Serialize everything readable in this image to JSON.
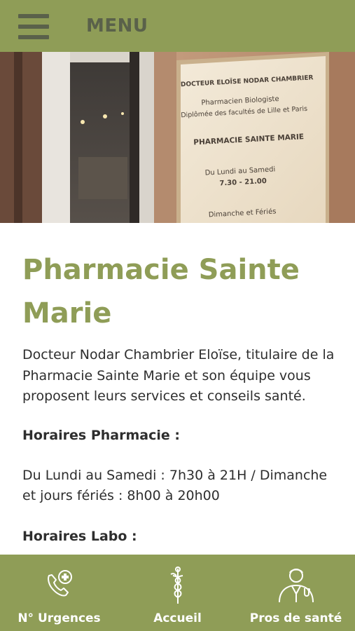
{
  "header": {
    "menu_icon": "hamburger-menu-icon",
    "menu_label": "MENU"
  },
  "hero": {
    "sign_lines": [
      "DOCTEUR ELOÏSE NODAR CHAMBRIER",
      "Pharmacien Biologiste",
      "Diplômée des facultés de Lille et Paris",
      "PHARMACIE SAINTE MARIE",
      "Du Lundi au Samedi",
      "7.30 - 21.00",
      "Dimanche et Fériés"
    ]
  },
  "content": {
    "title": "Pharmacie Sainte Marie",
    "intro": "Docteur Nodar Chambrier Eloïse, titulaire de la Pharmacie Sainte Marie et son équipe vous proposent leurs services et conseils santé.",
    "pharmacy_hours_heading": "Horaires Pharmacie :",
    "pharmacy_hours_text": "Du Lundi au Samedi : 7h30 à 21H / Dimanche et jours fériés : 8h00 à 20h00",
    "lab_hours_heading": "Horaires Labo :"
  },
  "bottom_nav": {
    "items": [
      {
        "label": "N° Urgences",
        "icon": "emergency-phone-icon"
      },
      {
        "label": "Accueil",
        "icon": "caduceus-icon"
      },
      {
        "label": "Pros de santé",
        "icon": "doctor-icon"
      }
    ]
  },
  "colors": {
    "brand_green": "#8f9d57",
    "header_text": "#5a614a",
    "body_text": "#2e2e2e"
  }
}
